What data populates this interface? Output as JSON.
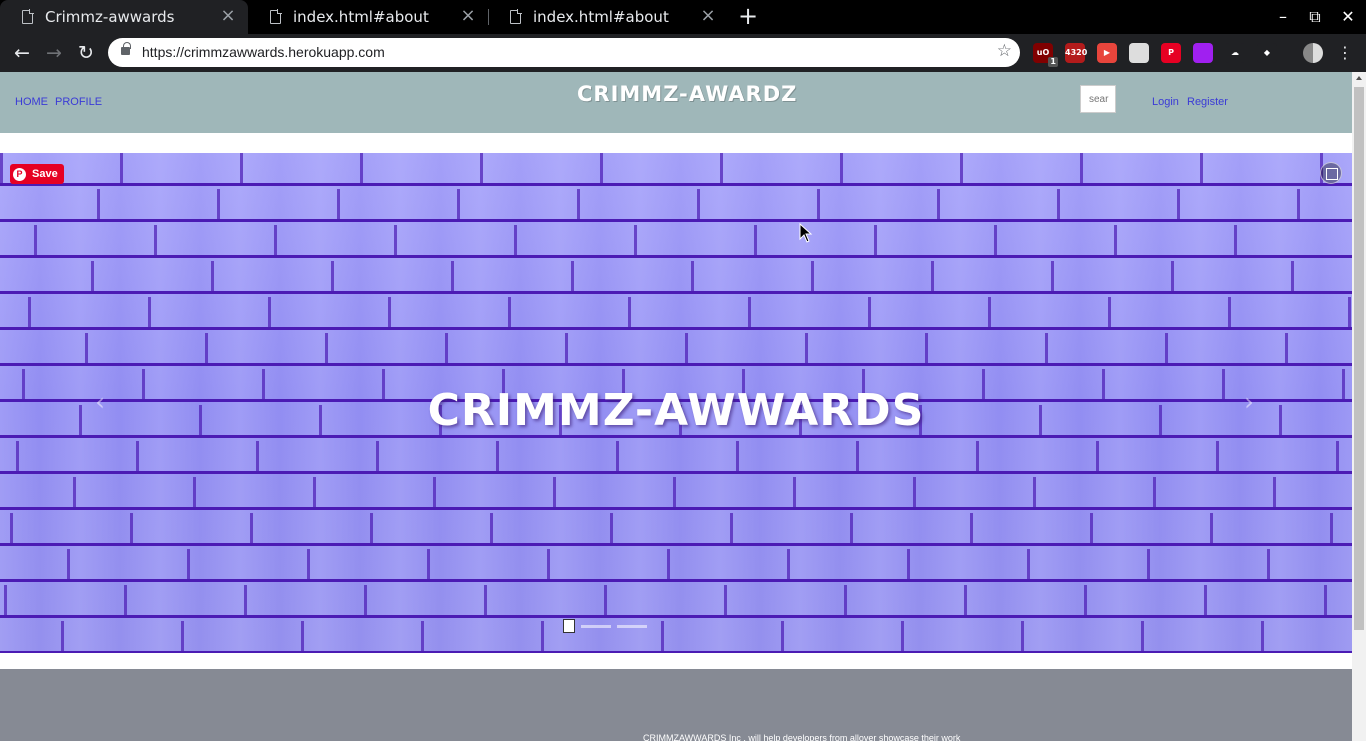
{
  "browser": {
    "tabs": [
      {
        "title": "Crimmz-awwards",
        "active": true
      },
      {
        "title": "index.html#about",
        "active": false
      },
      {
        "title": "index.html#about",
        "active": false
      }
    ],
    "new_tab_icon": "plus-icon",
    "url": "https://crimmzawwards.herokuapp.com",
    "extensions": [
      {
        "name": "ublock-icon",
        "badge": "1",
        "color": "#800000",
        "label": "uO"
      },
      {
        "name": "counter-extension-icon",
        "badge": "",
        "color": "#b31b1b",
        "label": "4320"
      },
      {
        "name": "video-extension-icon",
        "badge": "",
        "color": "#e8453c",
        "label": "▶"
      },
      {
        "name": "grid-extension-icon",
        "badge": "",
        "color": "#dddddd",
        "label": ""
      },
      {
        "name": "pinterest-icon",
        "badge": "",
        "color": "#e60023",
        "label": "P"
      },
      {
        "name": "purple-square-extension-icon",
        "badge": "",
        "color": "#a020f0",
        "label": ""
      },
      {
        "name": "cloud-extension-icon",
        "badge": "",
        "color": "#202124",
        "label": "☁"
      },
      {
        "name": "cube-extension-icon",
        "badge": "",
        "color": "#202124",
        "label": "◆"
      }
    ]
  },
  "site": {
    "nav": {
      "home": "HOME",
      "profile": "PROFILE",
      "brand": "CRIMMZ-AWARDZ",
      "search_placeholder": "sear",
      "login": "Login",
      "register": "Register"
    },
    "carousel": {
      "title": "CRIMMZ-AWWARDS",
      "save_label": "Save",
      "slide_count": 3,
      "active_slide": 0
    },
    "footer": {
      "text": "CRIMMZAWWARDS Inc , will help developers from allover showcase their work"
    }
  },
  "colors": {
    "nav_bg": "#9fb7b9",
    "link": "#3b3bd6",
    "footer_bg": "#868a94",
    "carousel_bg": "#8c88f2",
    "pinterest": "#e60023"
  }
}
